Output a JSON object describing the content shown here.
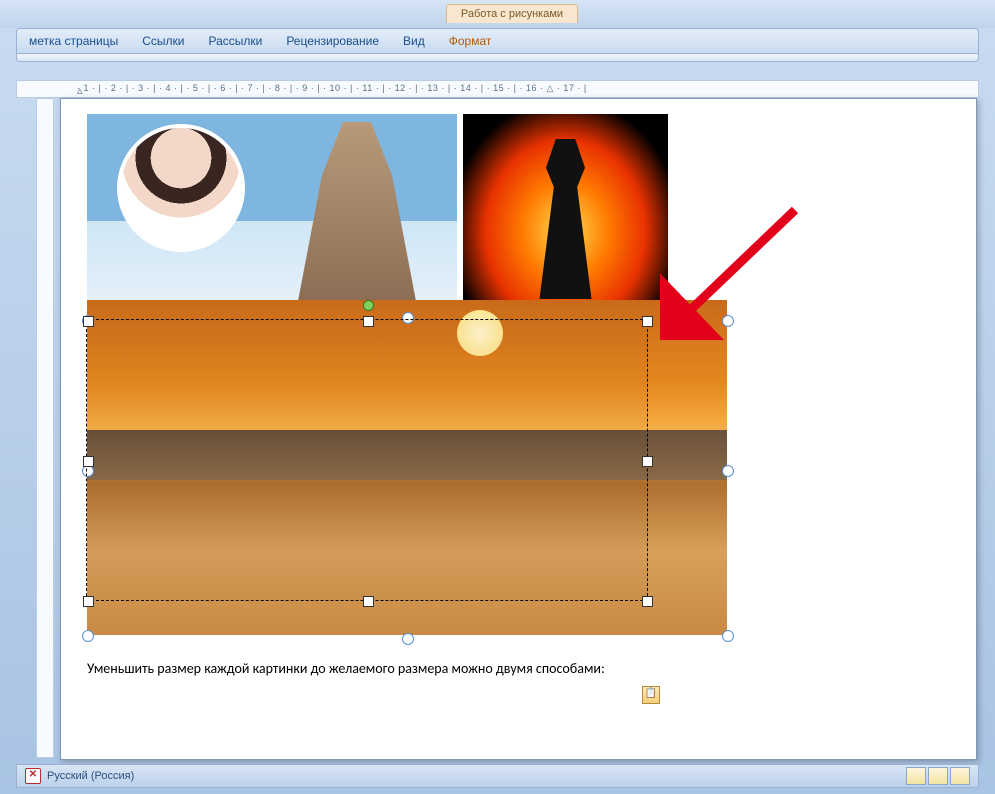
{
  "context_tab": "Работа с рисунками",
  "tabs": {
    "page_layout": "метка страницы",
    "references": "Ссылки",
    "mailings": "Рассылки",
    "review": "Рецензирование",
    "view": "Вид",
    "format": "Формат"
  },
  "ruler": "· 1 · | · 2 · | · 3 · | · 4 · | · 5 · | · 6 · | · 7 · | · 8 · | · 9 · | · 10 · | · 11 · | · 12 · | · 13 · | · 14 · | · 15 · | · 16 · △ · 17 · |",
  "ruler_left_marker": "▵",
  "doc_text": "Уменьшить размер каждой картинки до желаемого размера можно двумя способами:",
  "paste_icon_glyph": "📋",
  "status": {
    "x": "✕",
    "language": "Русский (Россия)"
  }
}
